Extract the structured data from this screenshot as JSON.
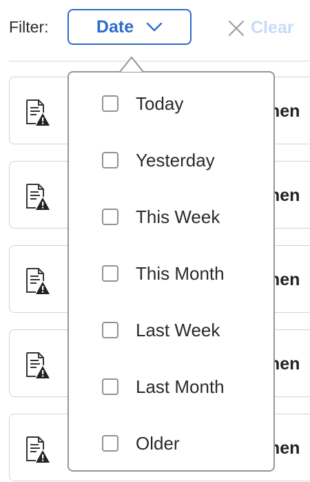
{
  "filter": {
    "label": "Filter:",
    "selected": "Date",
    "clear_label": "Clear"
  },
  "dropdown": {
    "options": [
      {
        "label": "Today",
        "checked": false
      },
      {
        "label": "Yesterday",
        "checked": false
      },
      {
        "label": "This Week",
        "checked": false
      },
      {
        "label": "This Month",
        "checked": false
      },
      {
        "label": "Last Week",
        "checked": false
      },
      {
        "label": "Last Month",
        "checked": false
      },
      {
        "label": "Older",
        "checked": false
      }
    ]
  },
  "list": {
    "items": [
      {
        "text": "men",
        "icon": "document-warning-icon"
      },
      {
        "text": "men",
        "icon": "document-warning-icon"
      },
      {
        "text": "men",
        "icon": "document-warning-icon"
      },
      {
        "text": "men",
        "icon": "document-warning-icon"
      },
      {
        "text": "men",
        "icon": "document-warning-icon"
      }
    ]
  },
  "colors": {
    "accent": "#2e6ac9",
    "clear_disabled": "#c7dbf7",
    "border": "#8e969e"
  }
}
